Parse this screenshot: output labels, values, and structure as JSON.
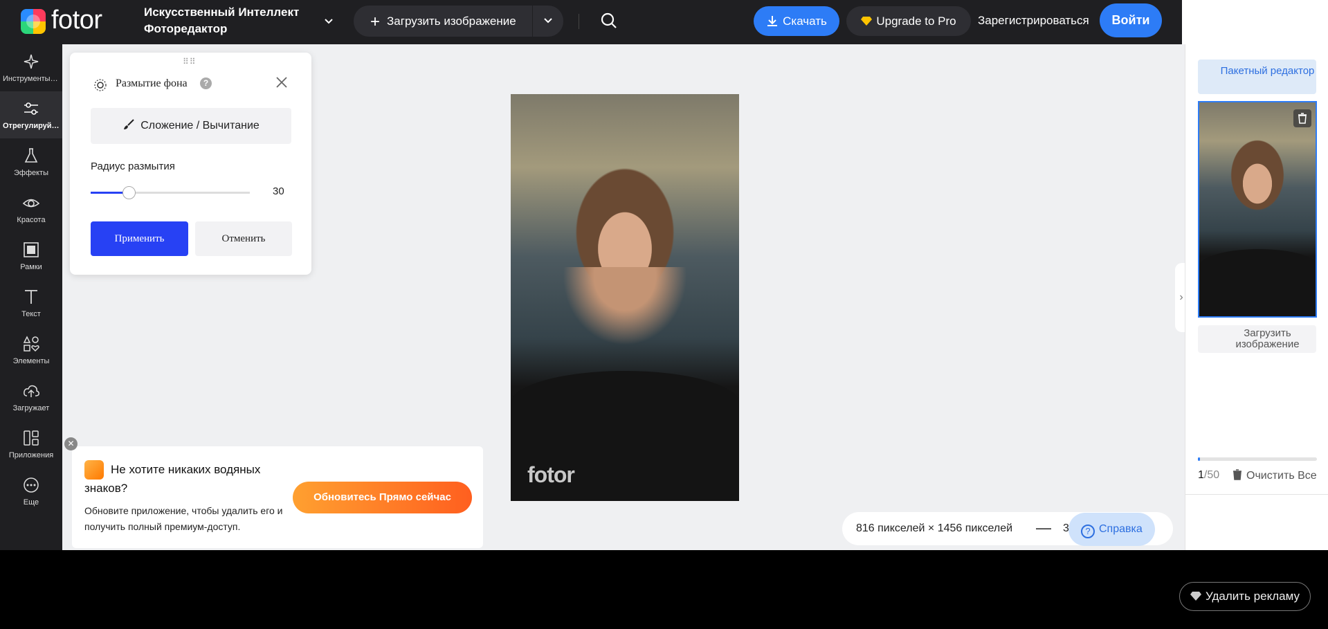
{
  "header": {
    "logo": "fotor",
    "app_title_line1": "Искусственный Интеллект",
    "app_title_line2": "Фоторедактор",
    "upload_label": "Загрузить изображение",
    "download_label": "Скачать",
    "upgrade_label": "Upgrade to Pro",
    "register_label": "Зарегистрироваться",
    "login_label": "Войти"
  },
  "sidebar": {
    "items": [
      {
        "label": "Инструменты ИИ",
        "icon": "sparkle-icon"
      },
      {
        "label": "Отрегулируйте",
        "icon": "sliders-icon",
        "active": true
      },
      {
        "label": "Эффекты",
        "icon": "flask-icon"
      },
      {
        "label": "Красота",
        "icon": "eye-icon"
      },
      {
        "label": "Рамки",
        "icon": "frame-icon"
      },
      {
        "label": "Текст",
        "icon": "text-icon"
      },
      {
        "label": "Элементы",
        "icon": "shapes-icon"
      },
      {
        "label": "Загружает",
        "icon": "cloud-upload-icon"
      },
      {
        "label": "Приложения",
        "icon": "apps-icon"
      },
      {
        "label": "Еще",
        "icon": "more-icon"
      }
    ]
  },
  "blur_panel": {
    "title": "Размытие фона",
    "help": "?",
    "add_subtract_label": "Сложение / Вычитание",
    "radius_label": "Радиус размытия",
    "radius_value": "30",
    "radius_fraction": 0.24,
    "apply_label": "Применить",
    "cancel_label": "Отменить"
  },
  "canvas": {
    "watermark": "fotor",
    "dimensions": "816 пикселей × 1456 пикселей",
    "zoom_value": "3",
    "help_label": "Справка"
  },
  "promo": {
    "title": "Не хотите никаких водяных знаков?",
    "subtitle": "Обновите приложение, чтобы удалить его и получить полный премиум-доступ.",
    "button_label": "Обновитесь Прямо сейчас"
  },
  "right_panel": {
    "batch_label": "Пакетный редактор",
    "upload_label": "Загрузить изображение",
    "count_current": "1",
    "count_total": "/50",
    "progress_fraction": 0.02,
    "clear_label": "Очистить Все"
  },
  "ad_bar": {
    "remove_label": "Удалить рекламу"
  },
  "colors": {
    "accent_blue": "#2d7cf6",
    "apply_blue": "#2741f4",
    "dark_bg": "#1f1f22"
  }
}
